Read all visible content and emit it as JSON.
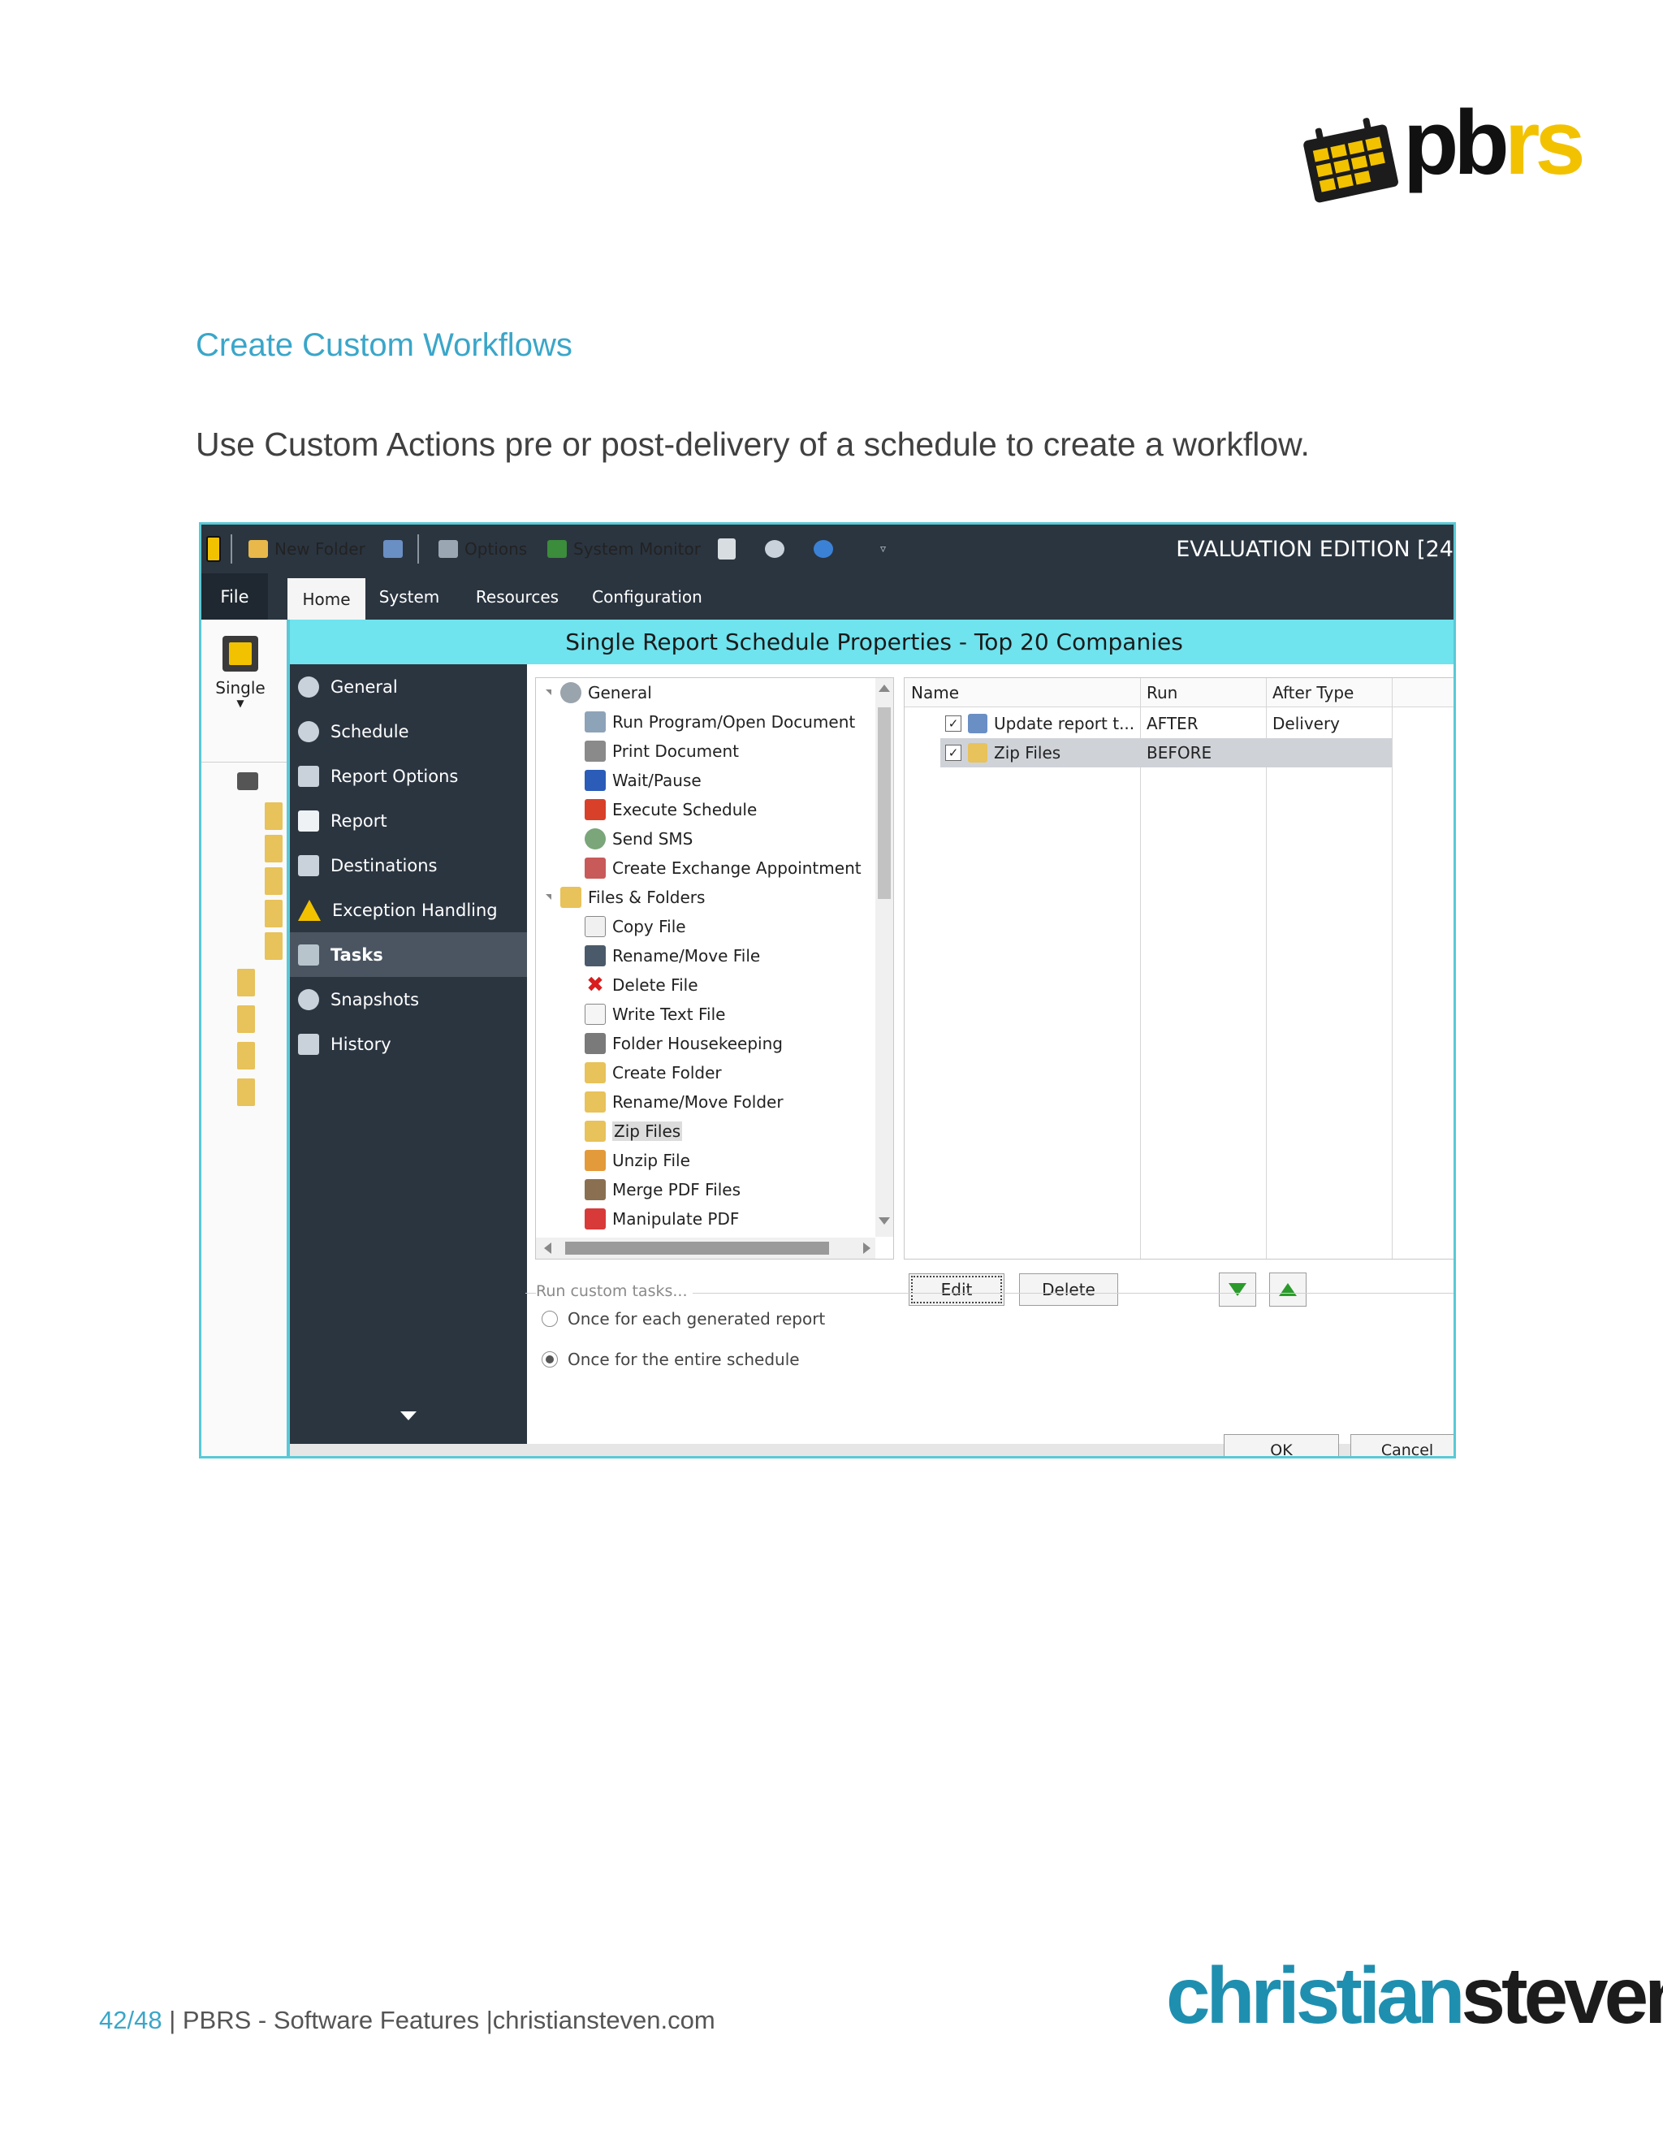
{
  "page": {
    "heading": "Create Custom Workflows",
    "lead": "Use Custom Actions pre or post-delivery of a schedule to create a workflow.",
    "footer": {
      "page": "42/48",
      "separator": " | ",
      "text": "PBRS - Software Features |christiansteven.com"
    }
  },
  "logos": {
    "pbrs": {
      "part1": "pb",
      "part2": "rs"
    },
    "christiansteven": {
      "part1": "christian",
      "part2": "steven"
    }
  },
  "app": {
    "quick_access": {
      "new_folder": "New Folder",
      "options": "Options",
      "system_monitor": "System Monitor"
    },
    "edition": "EVALUATION EDITION [24",
    "file_tab": "File",
    "tabs": [
      "Home",
      "System",
      "Resources",
      "Configuration"
    ],
    "single_button": "Single",
    "dialog": {
      "title": "Single Report Schedule Properties - Top 20 Companies",
      "nav": [
        {
          "label": "General",
          "icon": "info-icon"
        },
        {
          "label": "Schedule",
          "icon": "clock-icon"
        },
        {
          "label": "Report Options",
          "icon": "options-icon"
        },
        {
          "label": "Report",
          "icon": "report-icon"
        },
        {
          "label": "Destinations",
          "icon": "destinations-icon"
        },
        {
          "label": "Exception Handling",
          "icon": "warning-icon"
        },
        {
          "label": "Tasks",
          "icon": "tasks-icon"
        },
        {
          "label": "Snapshots",
          "icon": "snapshot-icon"
        },
        {
          "label": "History",
          "icon": "history-icon"
        }
      ],
      "task_tree": [
        {
          "label": "General",
          "level": 0,
          "icon": "gear-icon"
        },
        {
          "label": "Run Program/Open Document",
          "level": 1,
          "icon": "run-icon"
        },
        {
          "label": "Print Document",
          "level": 1,
          "icon": "printer-icon"
        },
        {
          "label": "Wait/Pause",
          "level": 1,
          "icon": "pause-icon"
        },
        {
          "label": "Execute Schedule",
          "level": 1,
          "icon": "execute-icon"
        },
        {
          "label": "Send SMS",
          "level": 1,
          "icon": "sms-icon"
        },
        {
          "label": "Create Exchange Appointment",
          "level": 1,
          "icon": "appointment-icon"
        },
        {
          "label": "Files & Folders",
          "level": 0,
          "icon": "folder-icon"
        },
        {
          "label": "Copy File",
          "level": 1,
          "icon": "copy-file-icon"
        },
        {
          "label": "Rename/Move File",
          "level": 1,
          "icon": "rename-file-icon"
        },
        {
          "label": "Delete File",
          "level": 1,
          "icon": "delete-icon"
        },
        {
          "label": "Write Text File",
          "level": 1,
          "icon": "write-file-icon"
        },
        {
          "label": "Folder Housekeeping",
          "level": 1,
          "icon": "housekeeping-icon"
        },
        {
          "label": "Create Folder",
          "level": 1,
          "icon": "create-folder-icon"
        },
        {
          "label": "Rename/Move Folder",
          "level": 1,
          "icon": "rename-folder-icon"
        },
        {
          "label": "Zip Files",
          "level": 1,
          "icon": "zip-icon"
        },
        {
          "label": "Unzip File",
          "level": 1,
          "icon": "unzip-icon"
        },
        {
          "label": "Merge PDF Files",
          "level": 1,
          "icon": "merge-pdf-icon"
        },
        {
          "label": "Manipulate PDF",
          "level": 1,
          "icon": "pdf-icon"
        }
      ],
      "grid": {
        "columns": [
          "Name",
          "Run",
          "After Type"
        ],
        "rows": [
          {
            "name": "Update report t...",
            "run": "AFTER",
            "after_type": "Delivery",
            "checked": true
          },
          {
            "name": "Zip Files",
            "run": "BEFORE",
            "after_type": "",
            "checked": true
          }
        ]
      },
      "buttons": {
        "edit": "Edit",
        "delete": "Delete",
        "ok": "OK",
        "cancel": "Cancel"
      },
      "run_custom_tasks": {
        "label": "Run custom tasks...",
        "options": [
          "Once for each generated report",
          "Once for the entire schedule"
        ],
        "selected": "Once for the entire schedule"
      }
    }
  },
  "colors": {
    "accent_teal": "#3aa6c9",
    "dialog_title_bar": "#6fe3ee",
    "dark_panel": "#2b3540",
    "pbrs_yellow": "#f2c200"
  }
}
